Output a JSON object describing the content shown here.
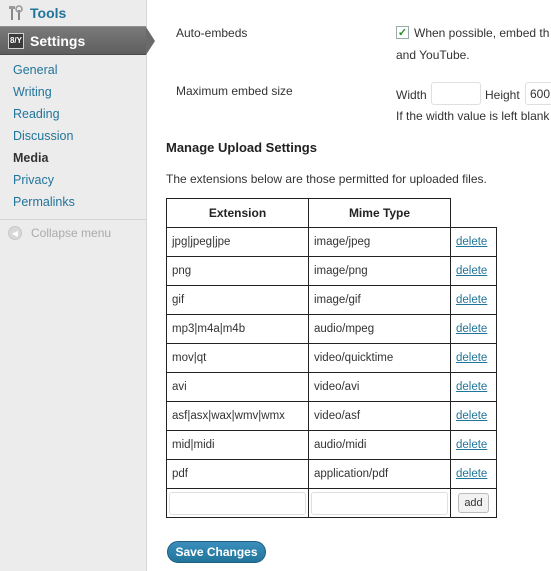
{
  "sidebar": {
    "tools_label": "Tools",
    "settings_label": "Settings",
    "settings_icon_text": "8/Y",
    "items": [
      {
        "label": "General"
      },
      {
        "label": "Writing"
      },
      {
        "label": "Reading"
      },
      {
        "label": "Discussion"
      },
      {
        "label": "Media"
      },
      {
        "label": "Privacy"
      },
      {
        "label": "Permalinks"
      }
    ],
    "current_item": "Media",
    "collapse_label": "Collapse menu"
  },
  "embeds": {
    "auto_label": "Auto-embeds",
    "auto_checked": true,
    "auto_text_line1": "When possible, embed th",
    "auto_text_line2": "and YouTube.",
    "max_label": "Maximum embed size",
    "width_label": "Width",
    "width_value": "",
    "height_label": "Height",
    "height_value": "600",
    "hint": "If the width value is left blank"
  },
  "upload": {
    "title": "Manage Upload Settings",
    "description": "The extensions below are those permitted for uploaded files.",
    "col_extension": "Extension",
    "col_mime": "Mime Type",
    "delete_label": "delete",
    "rows": [
      {
        "ext": "jpg|jpeg|jpe",
        "mime": "image/jpeg"
      },
      {
        "ext": "png",
        "mime": "image/png"
      },
      {
        "ext": "gif",
        "mime": "image/gif"
      },
      {
        "ext": "mp3|m4a|m4b",
        "mime": "audio/mpeg"
      },
      {
        "ext": "mov|qt",
        "mime": "video/quicktime"
      },
      {
        "ext": "avi",
        "mime": "video/avi"
      },
      {
        "ext": "asf|asx|wax|wmv|wmx",
        "mime": "video/asf"
      },
      {
        "ext": "mid|midi",
        "mime": "audio/midi"
      },
      {
        "ext": "pdf",
        "mime": "application/pdf"
      }
    ],
    "new_ext_value": "",
    "new_mime_value": "",
    "add_label": "add"
  },
  "save_label": "Save Changes",
  "colors": {
    "link": "#21759b",
    "sidebar_bg": "#ececec",
    "settings_head": "#6a6a6a",
    "save_button": "#21759b"
  }
}
